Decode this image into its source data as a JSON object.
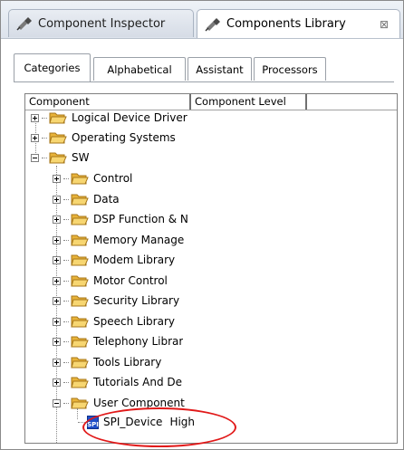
{
  "view_tabs": [
    {
      "label": "Component Inspector",
      "icon": "plug-icon"
    },
    {
      "label": "Components Library",
      "icon": "plug-icon",
      "close": "⊠"
    }
  ],
  "sub_tabs": [
    "Categories",
    "Alphabetical",
    "Assistant",
    "Processors"
  ],
  "table": {
    "columns": [
      "Component",
      "Component Level"
    ],
    "tree": [
      {
        "label": "Logical Device Driver"
      },
      {
        "label": "Operating Systems"
      },
      {
        "label": "SW"
      },
      {
        "label": "Control"
      },
      {
        "label": "Data"
      },
      {
        "label": "DSP Function & N"
      },
      {
        "label": "Memory Manage"
      },
      {
        "label": "Modem Library"
      },
      {
        "label": "Motor Control"
      },
      {
        "label": "Security Library"
      },
      {
        "label": "Speech Library"
      },
      {
        "label": "Telephony Librar"
      },
      {
        "label": "Tools Library"
      },
      {
        "label": "Tutorials And De"
      },
      {
        "label": "User Component"
      }
    ],
    "leaf": {
      "label": "SPI_Device",
      "level": "High",
      "icon_text": "SPI"
    }
  },
  "colors": {
    "highlight": "#e11919",
    "folder": "#f2c94c",
    "spi_icon": "#1f4fc8"
  }
}
